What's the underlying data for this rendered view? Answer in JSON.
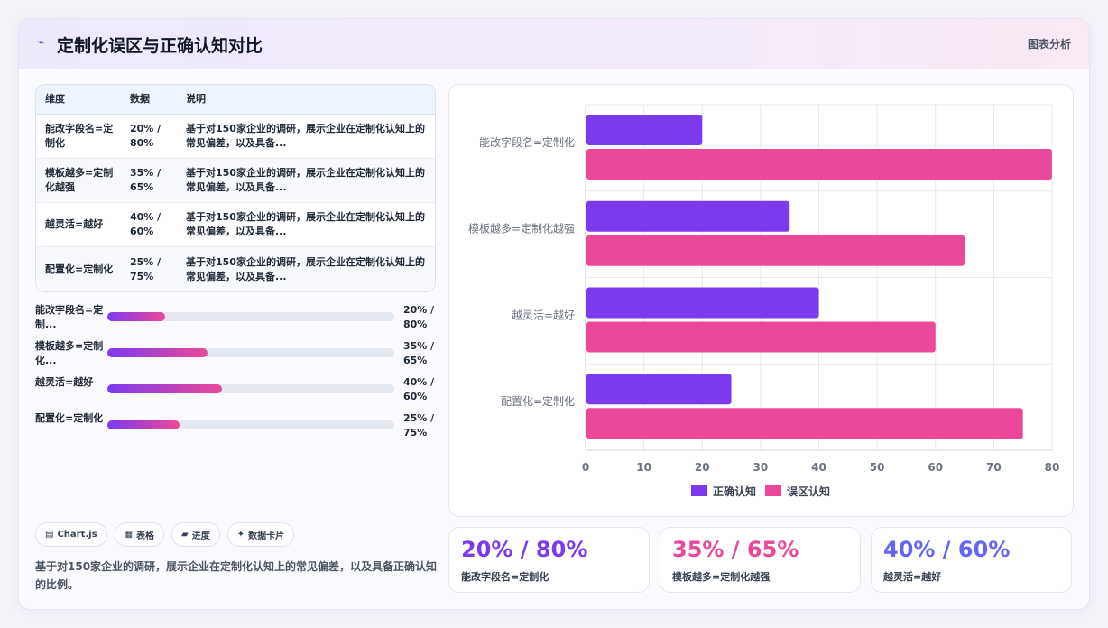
{
  "header": {
    "title": "定制化误区与正确认知对比",
    "tag": "图表分析"
  },
  "table": {
    "columns": [
      "维度",
      "数据",
      "说明"
    ],
    "rows": [
      {
        "dim": "能改字段名=定制化",
        "data": "20% / 80%",
        "desc": "基于对150家企业的调研，展示企业在定制化认知上的常见偏差，以及具备..."
      },
      {
        "dim": "模板越多=定制化越强",
        "data": "35% / 65%",
        "desc": "基于对150家企业的调研，展示企业在定制化认知上的常见偏差，以及具备..."
      },
      {
        "dim": "越灵活=越好",
        "data": "40% / 60%",
        "desc": "基于对150家企业的调研，展示企业在定制化认知上的常见偏差，以及具备..."
      },
      {
        "dim": "配置化=定制化",
        "data": "25% / 75%",
        "desc": "基于对150家企业的调研，展示企业在定制化认知上的常见偏差，以及具备..."
      }
    ]
  },
  "progress": [
    {
      "label": "能改字段名=定制...",
      "value_text": "20% / 80%",
      "fraction": 0.2
    },
    {
      "label": "模板越多=定制化...",
      "value_text": "35% / 65%",
      "fraction": 0.35
    },
    {
      "label": "越灵活=越好",
      "value_text": "40% / 60%",
      "fraction": 0.4
    },
    {
      "label": "配置化=定制化",
      "value_text": "25% / 75%",
      "fraction": 0.25
    }
  ],
  "chips": [
    {
      "icon": "▤",
      "label": "Chart.js"
    },
    {
      "icon": "▦",
      "label": "表格"
    },
    {
      "icon": "▰",
      "label": "进度"
    },
    {
      "icon": "✦",
      "label": "数据卡片"
    }
  ],
  "note": "基于对150家企业的调研，展示企业在定制化认知上的常见偏差，以及具备正确认知的比例。",
  "stats": [
    {
      "value": "20% / 80%",
      "label": "能改字段名=定制化",
      "color": "#7c3aed"
    },
    {
      "value": "35% / 65%",
      "label": "模板越多=定制化越强",
      "color": "#ec4899"
    },
    {
      "value": "40% / 60%",
      "label": "越灵活=越好",
      "color": "#6366f1"
    }
  ],
  "chart_data": {
    "type": "bar",
    "orientation": "horizontal",
    "categories": [
      "能改字段名=定制化",
      "模板越多=定制化越强",
      "越灵活=越好",
      "配置化=定制化"
    ],
    "series": [
      {
        "name": "正确认知",
        "values": [
          20,
          35,
          40,
          25
        ],
        "color": "#7c3aed"
      },
      {
        "name": "误区认知",
        "values": [
          80,
          65,
          60,
          75
        ],
        "color": "#ec4899"
      }
    ],
    "xlim": [
      0,
      80
    ],
    "xticks": [
      "0",
      "10",
      "20",
      "30",
      "40",
      "50",
      "60",
      "70",
      "80"
    ],
    "grid": true,
    "legend": "bottom"
  }
}
